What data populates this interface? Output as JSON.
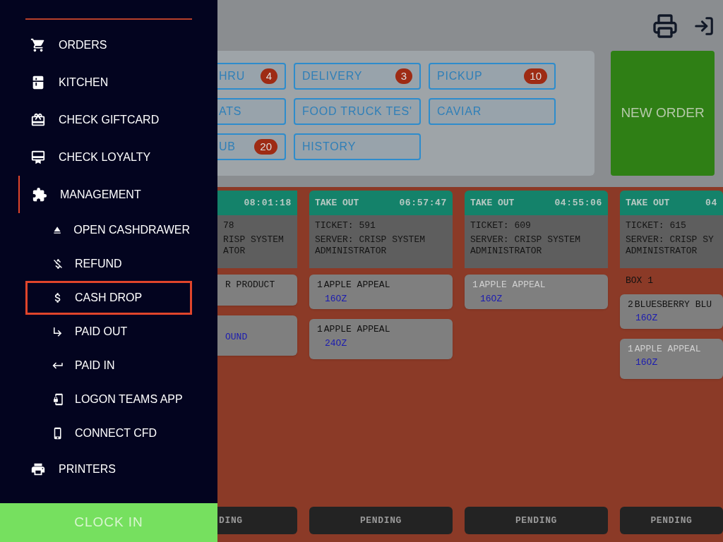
{
  "sidebar": {
    "items": [
      {
        "label": "ORDERS",
        "selected": false
      },
      {
        "label": "KITCHEN",
        "selected": false
      },
      {
        "label": "CHECK GIFTCARD",
        "selected": false
      },
      {
        "label": "CHECK LOYALTY",
        "selected": false
      },
      {
        "label": "MANAGEMENT",
        "selected": true,
        "children": [
          {
            "label": "OPEN CASHDRAWER",
            "highlighted": false
          },
          {
            "label": "REFUND",
            "highlighted": false
          },
          {
            "label": "CASH DROP",
            "highlighted": true
          },
          {
            "label": "PAID OUT",
            "highlighted": false
          },
          {
            "label": "PAID IN",
            "highlighted": false
          },
          {
            "label": "LOGON TEAMS APP",
            "highlighted": false
          },
          {
            "label": "CONNECT CFD",
            "highlighted": false
          }
        ]
      },
      {
        "label": "PRINTERS",
        "selected": false
      }
    ],
    "clock_in": "CLOCK IN"
  },
  "order_types": [
    {
      "label": "HRU",
      "count": "4"
    },
    {
      "label": "DELIVERY",
      "count": "3"
    },
    {
      "label": "PICKUP",
      "count": "10"
    },
    {
      "label": "ATS"
    },
    {
      "label": "FOOD TRUCK TES'"
    },
    {
      "label": "CAVIAR"
    },
    {
      "label": "UB",
      "count": "20"
    },
    {
      "label": "HISTORY"
    }
  ],
  "new_order": "NEW ORDER",
  "tickets": [
    {
      "time": "08:01:18",
      "info": [
        "78",
        "RISP SYSTEM",
        "ATOR"
      ],
      "items": [
        {
          "name": "R PRODUCT",
          "dimmed": false
        },
        {
          "size": "OUND"
        }
      ],
      "status": "DING"
    },
    {
      "type": "TAKE OUT",
      "time": "06:57:47",
      "info": [
        "TICKET: 591",
        "SERVER: CRISP SYSTEM",
        "ADMINISTRATOR"
      ],
      "items": [
        {
          "qty": "1",
          "name": "APPLE APPEAL",
          "size": "16OZ",
          "dimmed": false
        },
        {
          "qty": "1",
          "name": "APPLE APPEAL",
          "size": "24OZ",
          "dimmed": false
        }
      ],
      "status": "PENDING"
    },
    {
      "type": "TAKE OUT",
      "time": "04:55:06",
      "info": [
        "TICKET: 609",
        "SERVER: CRISP SYSTEM",
        "ADMINISTRATOR"
      ],
      "items": [
        {
          "qty": "1",
          "name": "APPLE APPEAL",
          "size": "16OZ",
          "dimmed": true
        }
      ],
      "status": "PENDING"
    },
    {
      "type": "TAKE OUT",
      "time": "04",
      "info": [
        "TICKET: 615",
        "SERVER: CRISP SY",
        "ADMINISTRATOR"
      ],
      "box": "BOX 1",
      "items": [
        {
          "qty": "2",
          "name": "BLUESBERRY BLU",
          "size": "16OZ",
          "dimmed": false
        },
        {
          "qty": "1",
          "name": "APPLE APPEAL",
          "size": "16OZ",
          "dimmed": true
        }
      ],
      "status": "PENDING"
    }
  ]
}
